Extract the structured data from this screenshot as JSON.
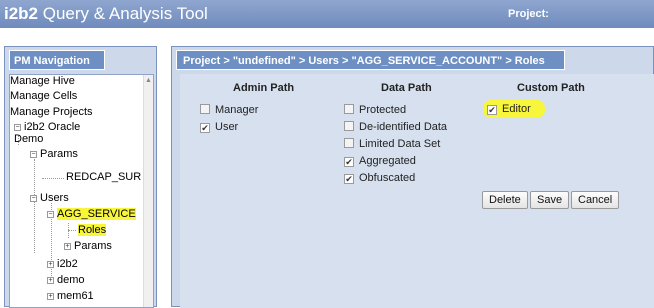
{
  "app": {
    "title_prefix": "i2b2",
    "title_rest": " Query & Analysis Tool",
    "project_label": "Project:"
  },
  "pm_navigation": {
    "tab_label": "PM Navigation",
    "tree": {
      "manage_hive": "Manage Hive",
      "manage_cells": "Manage Cells",
      "manage_projects": "Manage Projects",
      "project_line1": "i2b2 Oracle",
      "project_line2": "Demo",
      "params": "Params",
      "redcap": "REDCAP_SUR",
      "users": "Users",
      "agg_service": "AGG_SERVICE",
      "roles": "Roles",
      "user_params": "Params",
      "i2b2": "i2b2",
      "demo": "demo",
      "mem61": "mem61"
    }
  },
  "roles_panel": {
    "breadcrumb": "Project > \"undefined\" > Users > \"AGG_SERVICE_ACCOUNT\" > Roles",
    "headers": {
      "admin": "Admin Path",
      "data": "Data Path",
      "custom": "Custom Path"
    },
    "admin_roles": [
      {
        "label": "Manager",
        "checked": false
      },
      {
        "label": "User",
        "checked": true
      }
    ],
    "data_roles": [
      {
        "label": "Protected",
        "checked": false
      },
      {
        "label": "De-identified Data",
        "checked": false
      },
      {
        "label": "Limited Data Set",
        "checked": false
      },
      {
        "label": "Aggregated",
        "checked": true
      },
      {
        "label": "Obfuscated",
        "checked": true
      }
    ],
    "custom_roles": [
      {
        "label": "Editor",
        "checked": true
      }
    ],
    "buttons": {
      "delete": "Delete",
      "save": "Save",
      "cancel": "Cancel"
    }
  },
  "colors": {
    "title_bar": "#7a94c4",
    "tab": "#6e8fc4",
    "panel": "#cdd8ea",
    "highlight": "#f8f63a"
  }
}
